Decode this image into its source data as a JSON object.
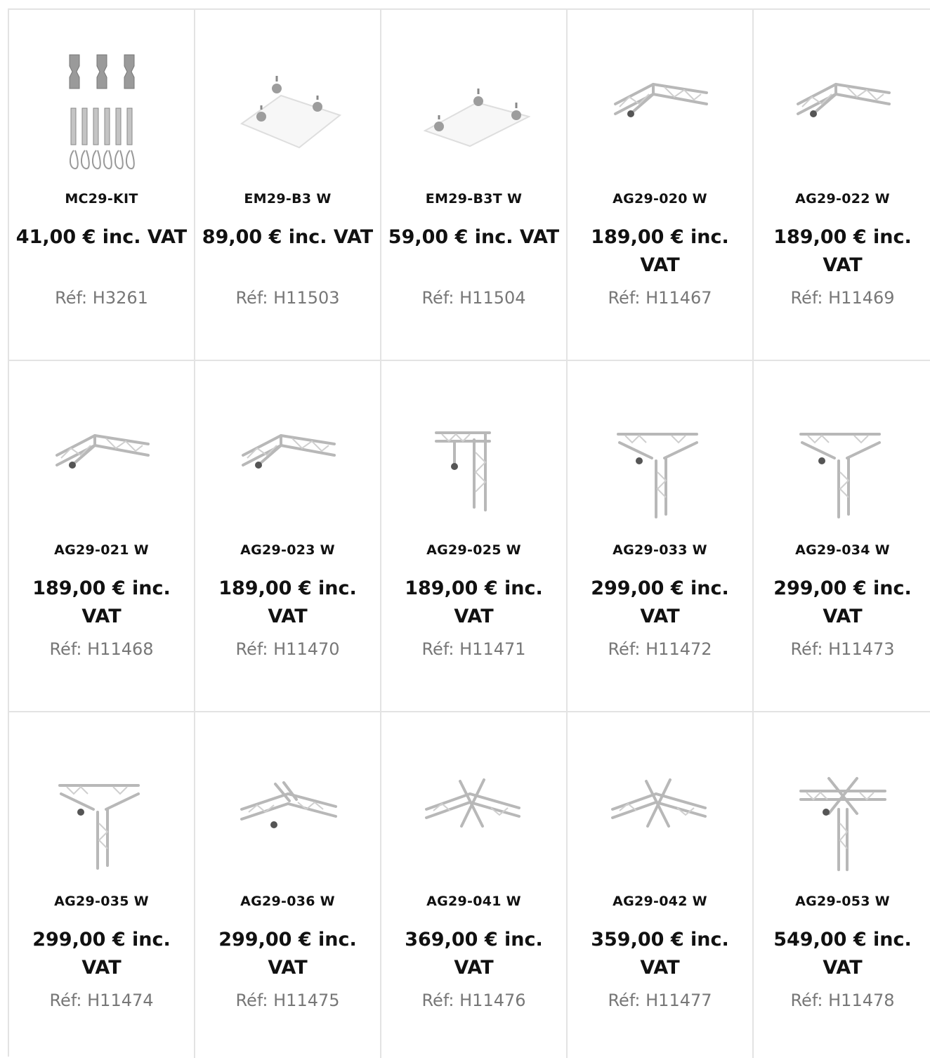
{
  "products": [
    {
      "name": "MC29-KIT",
      "price": "41,00 € inc. VAT",
      "ref": "Réf: H3261",
      "icon": "coupler-kit"
    },
    {
      "name": "EM29-B3 W",
      "price": "89,00 € inc. VAT",
      "ref": "Réf: H11503",
      "icon": "base-plate"
    },
    {
      "name": "EM29-B3T W",
      "price": "59,00 € inc. VAT",
      "ref": "Réf: H11504",
      "icon": "base-plate-triangle"
    },
    {
      "name": "AG29-020 W",
      "price": "189,00 € inc. VAT",
      "ref": "Réf: H11467",
      "icon": "truss-corner-2way"
    },
    {
      "name": "AG29-022 W",
      "price": "189,00 € inc. VAT",
      "ref": "Réf: H11469",
      "icon": "truss-corner-2way"
    },
    {
      "name": "AG29-021 W",
      "price": "189,00 € inc. VAT",
      "ref": "Réf: H11468",
      "icon": "truss-corner-2way"
    },
    {
      "name": "AG29-023 W",
      "price": "189,00 € inc. VAT",
      "ref": "Réf: H11470",
      "icon": "truss-corner-2way"
    },
    {
      "name": "AG29-025 W",
      "price": "189,00 € inc. VAT",
      "ref": "Réf: H11471",
      "icon": "truss-corner-vertical"
    },
    {
      "name": "AG29-033 W",
      "price": "299,00 € inc. VAT",
      "ref": "Réf: H11472",
      "icon": "truss-corner-3way"
    },
    {
      "name": "AG29-034 W",
      "price": "299,00 € inc. VAT",
      "ref": "Réf: H11473",
      "icon": "truss-corner-3way"
    },
    {
      "name": "AG29-035 W",
      "price": "299,00 € inc. VAT",
      "ref": "Réf: H11474",
      "icon": "truss-corner-3way"
    },
    {
      "name": "AG29-036 W",
      "price": "299,00 € inc. VAT",
      "ref": "Réf: H11475",
      "icon": "truss-t-junction"
    },
    {
      "name": "AG29-041 W",
      "price": "369,00 € inc. VAT",
      "ref": "Réf: H11476",
      "icon": "truss-cross-4way"
    },
    {
      "name": "AG29-042 W",
      "price": "359,00 € inc. VAT",
      "ref": "Réf: H11477",
      "icon": "truss-cross-4way"
    },
    {
      "name": "AG29-053 W",
      "price": "549,00 € inc. VAT",
      "ref": "Réf: H11478",
      "icon": "truss-cross-5way"
    }
  ]
}
